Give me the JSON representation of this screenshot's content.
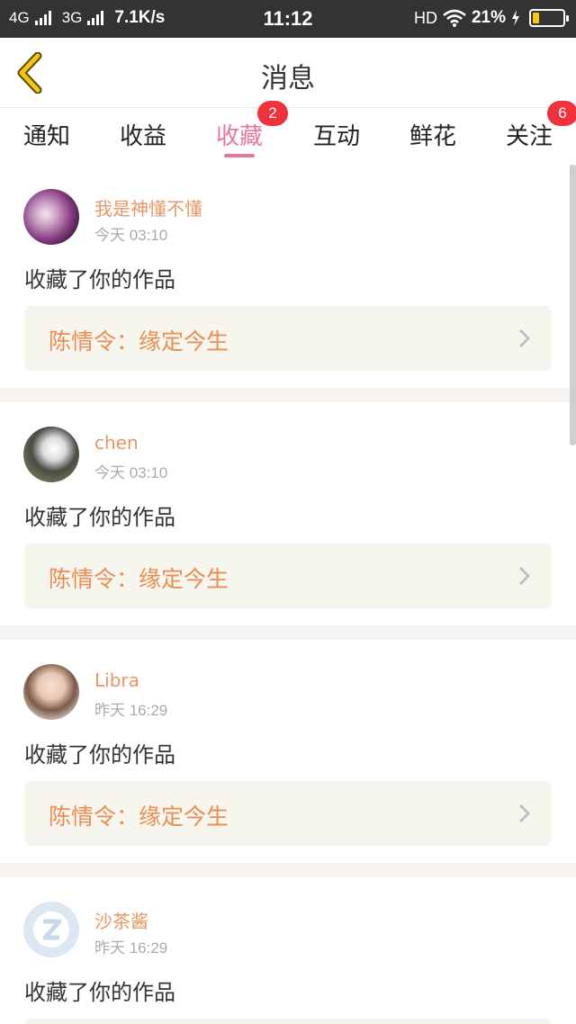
{
  "status_bar": {
    "left_text_1": "4G",
    "left_text_2": "3G",
    "speed": "7.1K/s",
    "time": "11:12",
    "hd": "HD",
    "battery": "21%",
    "battery_level": 0.21,
    "icons": [
      "signal-icon",
      "wifi-icon",
      "charging-icon",
      "battery-icon"
    ]
  },
  "header": {
    "title": "消息",
    "back_icon": "chevron-left-icon"
  },
  "tabs": [
    {
      "label": "通知"
    },
    {
      "label": "收益"
    },
    {
      "label": "收藏",
      "badge": "2",
      "active": true
    },
    {
      "label": "互动"
    },
    {
      "label": "鲜花"
    },
    {
      "label": "关注",
      "badge": "6"
    }
  ],
  "items": [
    {
      "name": "我是神懂不懂",
      "time": "今天 03:10",
      "action": "收藏了你的作品",
      "work": "陈情令：缘定今生"
    },
    {
      "name": "chen",
      "time": "今天 03:10",
      "action": "收藏了你的作品",
      "work": "陈情令：缘定今生"
    },
    {
      "name": "Libra",
      "time": "昨天 16:29",
      "action": "收藏了你的作品",
      "work": "陈情令：缘定今生"
    },
    {
      "name": "沙茶酱",
      "time": "昨天 16:29",
      "action": "收藏了你的作品"
    }
  ],
  "colors": {
    "accent": "#e8779f",
    "username": "#e89663",
    "work_title": "#ec8e53",
    "badge": "#f0323c",
    "back_icon": "#f5c518"
  }
}
